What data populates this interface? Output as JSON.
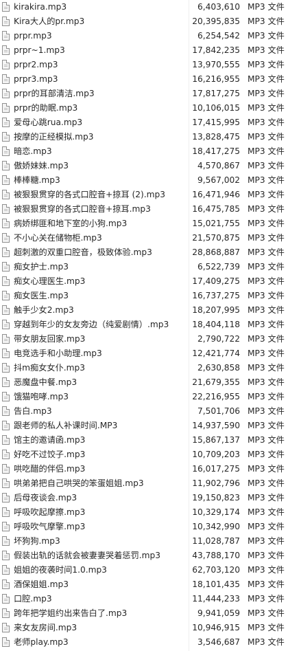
{
  "file_list": {
    "icon": "audio-file-icon",
    "files": [
      {
        "name": "kirakira.mp3",
        "size": "6,403,610",
        "type": "MP3 文件"
      },
      {
        "name": "Kira大人的pr.mp3",
        "size": "20,395,835",
        "type": "MP3 文件"
      },
      {
        "name": "prpr.mp3",
        "size": "6,254,542",
        "type": "MP3 文件"
      },
      {
        "name": "prpr~1.mp3",
        "size": "17,842,235",
        "type": "MP3 文件"
      },
      {
        "name": "prpr2.mp3",
        "size": "13,970,555",
        "type": "MP3 文件"
      },
      {
        "name": "prpr3.mp3",
        "size": "16,216,955",
        "type": "MP3 文件"
      },
      {
        "name": "prpr的耳部清洁.mp3",
        "size": "17,817,275",
        "type": "MP3 文件"
      },
      {
        "name": "prpr的助眠.mp3",
        "size": "10,106,015",
        "type": "MP3 文件"
      },
      {
        "name": "爱母心跳rua.mp3",
        "size": "17,415,995",
        "type": "MP3 文件"
      },
      {
        "name": "按摩的正经模拟.mp3",
        "size": "13,828,475",
        "type": "MP3 文件"
      },
      {
        "name": "暗恋.mp3",
        "size": "18,417,275",
        "type": "MP3 文件"
      },
      {
        "name": "傲娇妹妹.mp3",
        "size": "4,570,867",
        "type": "MP3 文件"
      },
      {
        "name": "棒棒糖.mp3",
        "size": "9,567,002",
        "type": "MP3 文件"
      },
      {
        "name": "被狠狠贯穿的各式口腔音+掠耳 (2).mp3",
        "size": "16,471,946",
        "type": "MP3 文件"
      },
      {
        "name": "被狠狠贯穿的各式口腔音+掠耳.mp3",
        "size": "16,475,785",
        "type": "MP3 文件"
      },
      {
        "name": "病娇绑匪和地下室的小狗.mp3",
        "size": "15,021,755",
        "type": "MP3 文件"
      },
      {
        "name": "不小心关在储物柜.mp3",
        "size": "21,570,875",
        "type": "MP3 文件"
      },
      {
        "name": "超刺激的双重口腔音，极致体验.mp3",
        "size": "28,868,887",
        "type": "MP3 文件"
      },
      {
        "name": "痴女护士.mp3",
        "size": "6,522,739",
        "type": "MP3 文件"
      },
      {
        "name": "痴女心理医生.mp3",
        "size": "17,409,275",
        "type": "MP3 文件"
      },
      {
        "name": "痴女医生.mp3",
        "size": "16,737,275",
        "type": "MP3 文件"
      },
      {
        "name": "触手少女2.mp3",
        "size": "18,207,995",
        "type": "MP3 文件"
      },
      {
        "name": "穿越到年少的女友旁边（纯爱剧情）.mp3",
        "size": "18,404,118",
        "type": "MP3 文件"
      },
      {
        "name": "带女朋友回家.mp3",
        "size": "2,790,722",
        "type": "MP3 文件"
      },
      {
        "name": "电竞选手和小助理.mp3",
        "size": "12,421,774",
        "type": "MP3 文件"
      },
      {
        "name": "抖m痴女女仆.mp3",
        "size": "2,630,858",
        "type": "MP3 文件"
      },
      {
        "name": "恶魔盘中餐.mp3",
        "size": "21,679,355",
        "type": "MP3 文件"
      },
      {
        "name": "饿猫咆哮.mp3",
        "size": "22,216,955",
        "type": "MP3 文件"
      },
      {
        "name": "告白.mp3",
        "size": "7,501,706",
        "type": "MP3 文件"
      },
      {
        "name": "跟老师的私人补课时间.MP3",
        "size": "14,937,590",
        "type": "MP3 文件"
      },
      {
        "name": "馆主的邀请函.mp3",
        "size": "15,867,137",
        "type": "MP3 文件"
      },
      {
        "name": "好吃不过饺子.mp3",
        "size": "10,709,203",
        "type": "MP3 文件"
      },
      {
        "name": "哄吃醋的伴侣.mp3",
        "size": "16,017,275",
        "type": "MP3 文件"
      },
      {
        "name": "哄弟弟把自己哄哭的笨蛋姐姐.mp3",
        "size": "11,902,796",
        "type": "MP3 文件"
      },
      {
        "name": "后母夜谈会.mp3",
        "size": "19,150,823",
        "type": "MP3 文件"
      },
      {
        "name": "呼吸吹起摩擦.mp3",
        "size": "10,329,174",
        "type": "MP3 文件"
      },
      {
        "name": "呼吸吹气摩擎.mp3",
        "size": "10,342,990",
        "type": "MP3 文件"
      },
      {
        "name": "坏狗狗.mp3",
        "size": "11,028,787",
        "type": "MP3 文件"
      },
      {
        "name": "假装出轨的话就会被妻妻哭着惩罚.mp3",
        "size": "43,788,170",
        "type": "MP3 文件"
      },
      {
        "name": "姐姐的夜袭时间1.0.mp3",
        "size": "62,703,120",
        "type": "MP3 文件"
      },
      {
        "name": "酒保姐姐.mp3",
        "size": "18,101,435",
        "type": "MP3 文件"
      },
      {
        "name": "口腔.mp3",
        "size": "11,444,233",
        "type": "MP3 文件"
      },
      {
        "name": "跨年把学姐约出来告白了.mp3",
        "size": "9,941,059",
        "type": "MP3 文件"
      },
      {
        "name": "来女友房间.mp3",
        "size": "10,946,915",
        "type": "MP3 文件"
      },
      {
        "name": "老师play.mp3",
        "size": "3,546,687",
        "type": "MP3 文件"
      }
    ]
  }
}
